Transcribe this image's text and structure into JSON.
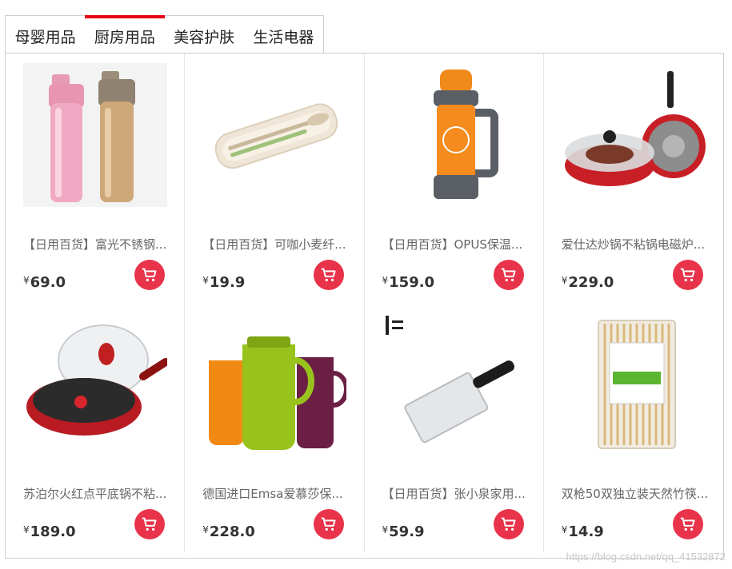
{
  "tabs": [
    {
      "label": "母婴用品",
      "active": false
    },
    {
      "label": "厨房用品",
      "active": true
    },
    {
      "label": "美容护肤",
      "active": false
    },
    {
      "label": "生活电器",
      "active": false
    }
  ],
  "currency_symbol": "¥",
  "products": [
    {
      "title": "【日用百货】富光不锈钢...",
      "price": "69.0",
      "image": "thermos-bottles"
    },
    {
      "title": "【日用百货】可咖小麦纤...",
      "price": "19.9",
      "image": "cutlery-set"
    },
    {
      "title": "【日用百货】OPUS保温...",
      "price": "159.0",
      "image": "orange-thermos"
    },
    {
      "title": "爱仕达炒锅不粘锅电磁炉...",
      "price": "229.0",
      "image": "red-wok-set"
    },
    {
      "title": "苏泊尔火红点平底锅不粘...",
      "price": "189.0",
      "image": "frying-pan"
    },
    {
      "title": "德国进口Emsa爱慕莎保...",
      "price": "228.0",
      "image": "jug-set"
    },
    {
      "title": "【日用百货】张小泉家用...",
      "price": "59.9",
      "image": "cleaver-knife"
    },
    {
      "title": "双枪50双独立装天然竹筷...",
      "price": "14.9",
      "image": "bamboo-chopsticks"
    }
  ],
  "watermark": "https://blog.csdn.net/qq_41532872",
  "colors": {
    "accent": "#e60012",
    "cart_button": "#e8334a"
  }
}
